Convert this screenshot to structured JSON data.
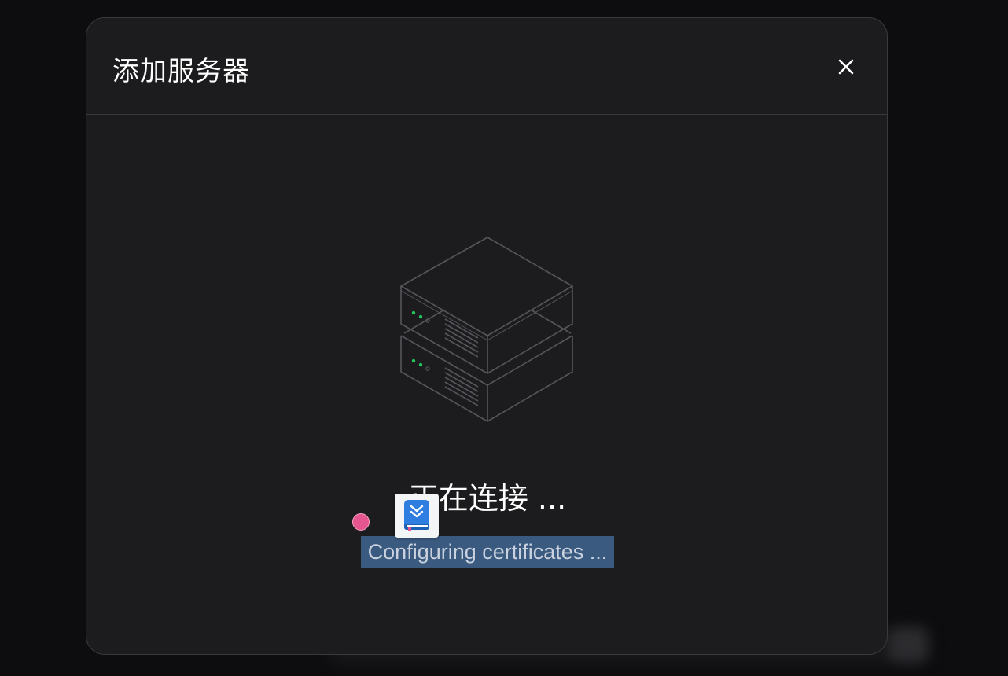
{
  "dialog": {
    "title": "添加服务器",
    "close_icon": "close-icon"
  },
  "illustration": {
    "icon": "server-stack-icon",
    "led_color": "#22c55e"
  },
  "status": {
    "title": "正在连接 ...",
    "subtitle": "Configuring certificates ..."
  },
  "overlay": {
    "cursor_color": "#e5558f",
    "app_icon": "download-book-app-icon"
  },
  "colors": {
    "dialog_bg": "#1c1c1e",
    "selection_bg": "#3b5a80",
    "accent_blue": "#2f7de1"
  }
}
